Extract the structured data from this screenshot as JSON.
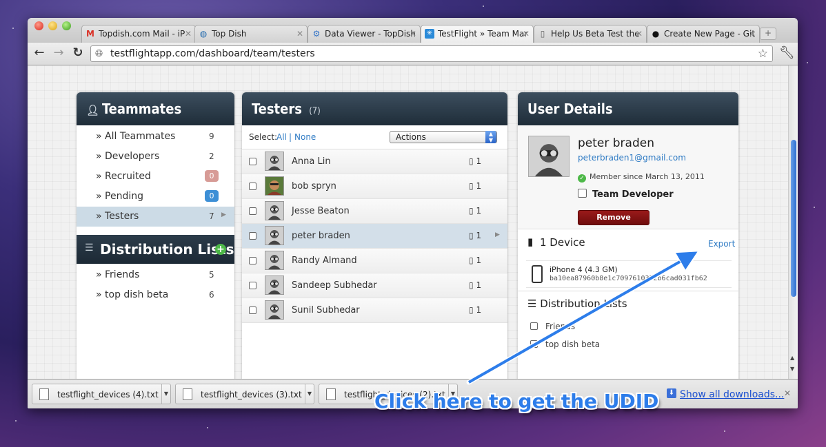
{
  "browser": {
    "tabs": [
      {
        "label": "Topdish.com Mail - iP",
        "favicon": "gmail-icon"
      },
      {
        "label": "Top Dish",
        "favicon": "topdish-icon"
      },
      {
        "label": "Data Viewer - TopDish",
        "favicon": "dataviewer-icon"
      },
      {
        "label": "TestFlight » Team Mar",
        "favicon": "testflight-icon"
      },
      {
        "label": "Help Us Beta Test the",
        "favicon": "document-icon"
      },
      {
        "label": "Create New Page - Git",
        "favicon": "github-icon"
      }
    ],
    "url": "testflightapp.com/dashboard/team/testers"
  },
  "teammates": {
    "title": "Teammates",
    "items": [
      {
        "label": "» All Teammates",
        "count": "9"
      },
      {
        "label": "» Developers",
        "count": "2"
      },
      {
        "label": "» Recruited",
        "count": "0"
      },
      {
        "label": "» Pending",
        "count": "0"
      },
      {
        "label": "» Testers",
        "count": "7"
      }
    ]
  },
  "distribution_lists": {
    "title": "Distribution Lists",
    "items": [
      {
        "label": "» Friends",
        "count": "5"
      },
      {
        "label": "» top dish beta",
        "count": "6"
      }
    ]
  },
  "testers": {
    "title": "Testers",
    "count": "(7)",
    "select_label": "Select:",
    "select_all": "All",
    "select_sep": "|",
    "select_none": "None",
    "actions_label": "Actions",
    "rows": [
      {
        "name": "Anna Lin",
        "devices": "1"
      },
      {
        "name": "bob spryn",
        "devices": "1"
      },
      {
        "name": "Jesse Beaton",
        "devices": "1"
      },
      {
        "name": "peter braden",
        "devices": "1"
      },
      {
        "name": "Randy Almand",
        "devices": "1"
      },
      {
        "name": "Sandeep Subhedar",
        "devices": "1"
      },
      {
        "name": "Sunil Subhedar",
        "devices": "1"
      }
    ]
  },
  "user_details": {
    "title": "User Details",
    "name": "peter braden",
    "email": "peterbraden1@gmail.com",
    "member_since": "Member since March 13, 2011",
    "team_developer": "Team Developer",
    "remove_label": "Remove",
    "devices_heading": "1 Device",
    "export_label": "Export",
    "device_model": "iPhone 4 (4.3 GM)",
    "device_udid": "ba10ea87960b8e1c7097610332b6cad031fb62",
    "dist_heading": "Distribution Lists",
    "dist_items": [
      "Friends",
      "top dish beta"
    ]
  },
  "downloads": {
    "items": [
      "testflight_devices (4).txt",
      "testflight_devices (3).txt",
      "testflight_devices (2).txt"
    ],
    "show_all": "Show all downloads..."
  },
  "annotation": {
    "text": "Click here to get the UDID",
    "color": "#2d7dea"
  }
}
